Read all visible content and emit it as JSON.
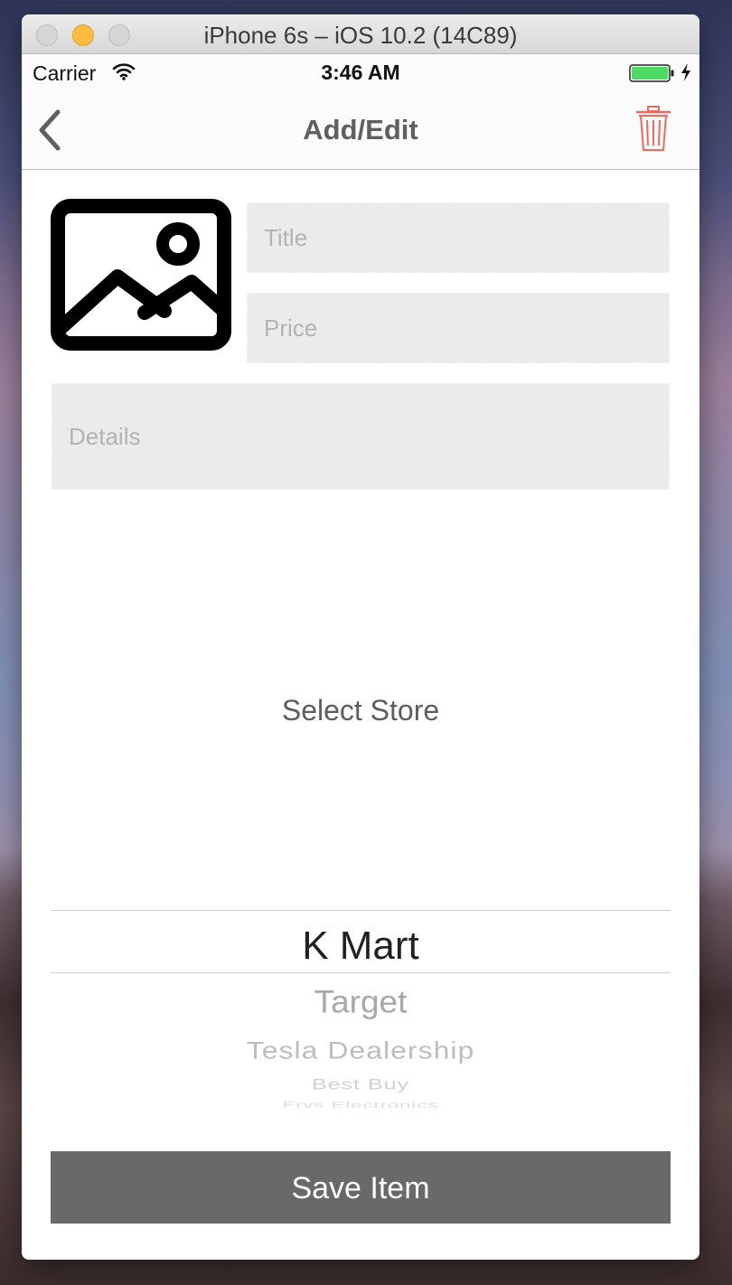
{
  "window": {
    "title": "iPhone 6s – iOS 10.2 (14C89)"
  },
  "status_bar": {
    "carrier": "Carrier",
    "time": "3:46 AM",
    "icons": [
      "wifi-icon",
      "battery-icon",
      "charging-icon"
    ],
    "battery_color": "#4cd964"
  },
  "nav_bar": {
    "title": "Add/Edit",
    "back_icon": "chevron-left-icon",
    "trash_icon": "trash-icon",
    "trash_color": "#f0695f"
  },
  "form": {
    "photo_icon": "image-placeholder-icon",
    "title_placeholder": "Title",
    "price_placeholder": "Price",
    "details_placeholder": "Details",
    "select_store_label": "Select Store"
  },
  "picker": {
    "selected": "K Mart",
    "options_below": [
      "Target",
      "Tesla Dealership",
      "Best Buy",
      "Frys Electronics"
    ]
  },
  "actions": {
    "save_label": "Save Item",
    "save_color": "#696969"
  }
}
